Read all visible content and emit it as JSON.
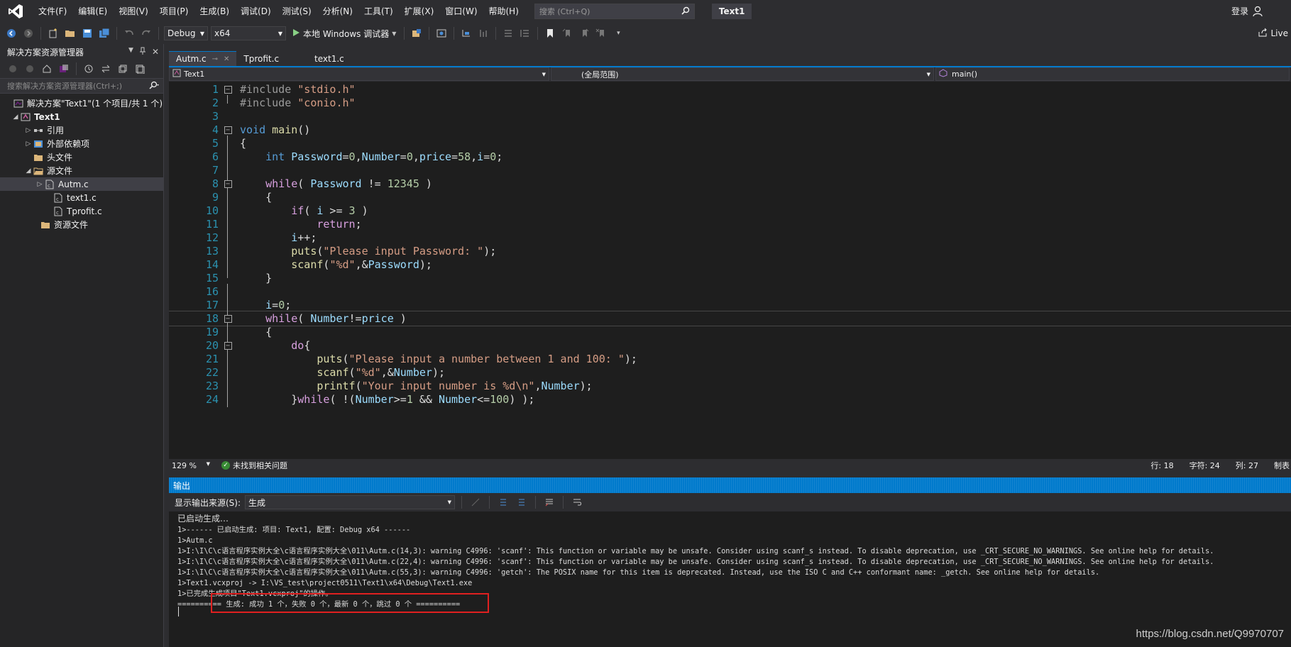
{
  "menu": {
    "items": [
      "文件(F)",
      "编辑(E)",
      "视图(V)",
      "项目(P)",
      "生成(B)",
      "调试(D)",
      "测试(S)",
      "分析(N)",
      "工具(T)",
      "扩展(X)",
      "窗口(W)",
      "帮助(H)"
    ],
    "search_placeholder": "搜索 (Ctrl+Q)",
    "solution_title": "Text1",
    "login": "登录"
  },
  "toolbar": {
    "config": "Debug",
    "platform": "x64",
    "run_label": "本地 Windows 调试器",
    "live_share": "Live"
  },
  "solution_explorer": {
    "title": "解决方案资源管理器",
    "search_placeholder": "搜索解决方案资源管理器(Ctrl+;)",
    "solution_label": "解决方案\"Text1\"(1 个项目/共 1 个)",
    "project": "Text1",
    "references": "引用",
    "external_deps": "外部依赖项",
    "header_files": "头文件",
    "source_files": "源文件",
    "file_autm": "Autm.c",
    "file_text1": "text1.c",
    "file_tprofit": "Tprofit.c",
    "resource_files": "资源文件"
  },
  "editor": {
    "tabs": [
      "Autm.c",
      "Tprofit.c",
      "text1.c"
    ],
    "nav_project": "Text1",
    "nav_scope": "(全局范围)",
    "nav_function": "main()",
    "line_numbers": [
      "1",
      "2",
      "3",
      "4",
      "5",
      "6",
      "7",
      "8",
      "9",
      "10",
      "11",
      "12",
      "13",
      "14",
      "15",
      "16",
      "17",
      "18",
      "19",
      "20",
      "21",
      "22",
      "23",
      "24"
    ]
  },
  "status": {
    "zoom": "129 %",
    "issues": "未找到相关问题",
    "line": "行: 18",
    "char": "字符: 24",
    "col": "列: 27",
    "tab_mode": "制表"
  },
  "output": {
    "title": "输出",
    "source_label": "显示输出来源(S):",
    "source_value": "生成",
    "lines": [
      "已启动生成…",
      "1>------ 已启动生成: 项目: Text1, 配置: Debug x64 ------",
      "1>Autm.c",
      "1>I:\\I\\C\\c语言程序实例大全\\c语言程序实例大全\\011\\Autm.c(14,3): warning C4996: 'scanf': This function or variable may be unsafe. Consider using scanf_s instead. To disable deprecation, use _CRT_SECURE_NO_WARNINGS. See online help for details.",
      "1>I:\\I\\C\\c语言程序实例大全\\c语言程序实例大全\\011\\Autm.c(22,4): warning C4996: 'scanf': This function or variable may be unsafe. Consider using scanf_s instead. To disable deprecation, use _CRT_SECURE_NO_WARNINGS. See online help for details.",
      "1>I:\\I\\C\\c语言程序实例大全\\c语言程序实例大全\\011\\Autm.c(55,3): warning C4996: 'getch': The POSIX name for this item is deprecated. Instead, use the ISO C and C++ conformant name: _getch. See online help for details.",
      "1>Text1.vcxproj -> I:\\VS_test\\project0511\\Text1\\x64\\Debug\\Text1.exe",
      "1>已完成生成项目\"Text1.vcxproj\"的操作。",
      "========== 生成: 成功 1 个，失败 0 个，最新 0 个，跳过 0 个 =========="
    ]
  },
  "watermark": "https://blog.csdn.net/Q9970707",
  "colors": {
    "accent": "#007acc",
    "highlight_box": "#e02020"
  }
}
